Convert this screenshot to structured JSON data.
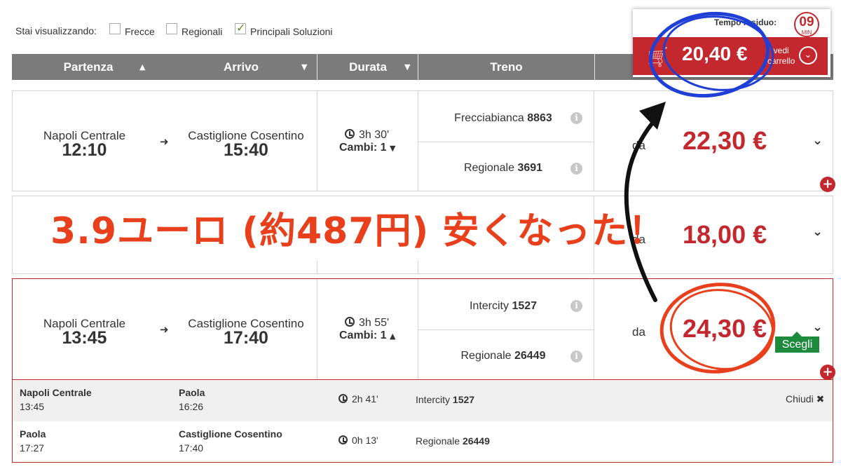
{
  "filters": {
    "label": "Stai visualizzando:",
    "options": [
      {
        "label": "Frecce",
        "checked": false
      },
      {
        "label": "Regionali",
        "checked": false
      },
      {
        "label": "Principali Soluzioni",
        "checked": true
      }
    ]
  },
  "table_header": {
    "partenza": "Partenza",
    "arrivo": "Arrivo",
    "durata": "Durata",
    "treno": "Treno"
  },
  "cart": {
    "tempo_label": "Tempo residuo:",
    "timer_value": "09",
    "timer_unit": "MIN",
    "price": "20,40 €",
    "vedi_line1": "vedi",
    "vedi_line2": "carrello"
  },
  "solutions": [
    {
      "from_station": "Napoli Centrale",
      "from_time": "12:10",
      "to_station": "Castiglione Cosentino",
      "to_time": "15:40",
      "duration": "3h 30'",
      "cambi": "Cambi: 1",
      "trains": [
        {
          "type": "Frecciabianca",
          "number": "8863"
        },
        {
          "type": "Regionale",
          "number": "3691"
        }
      ],
      "da": "da",
      "price": "22,30 €"
    },
    {
      "da": "da",
      "price": "18,00 €"
    },
    {
      "from_station": "Napoli Centrale",
      "from_time": "13:45",
      "to_station": "Castiglione Cosentino",
      "to_time": "17:40",
      "duration": "3h 55'",
      "cambi": "Cambi: 1",
      "trains": [
        {
          "type": "Intercity",
          "number": "1527"
        },
        {
          "type": "Regionale",
          "number": "26449"
        }
      ],
      "da": "da",
      "price": "24,30 €",
      "select_label": "Scegli",
      "details": [
        {
          "from_station": "Napoli Centrale",
          "from_time": "13:45",
          "to_station": "Paola",
          "to_time": "16:26",
          "duration": "2h 41'",
          "train_type": "Intercity",
          "train_number": "1527"
        },
        {
          "from_station": "Paola",
          "from_time": "17:27",
          "to_station": "Castiglione Cosentino",
          "to_time": "17:40",
          "duration": "0h 13'",
          "train_type": "Regionale",
          "train_number": "26449"
        }
      ],
      "close_label": "Chiudi"
    }
  ],
  "annotation": {
    "text": "3.9ユーロ (約487円) 安くなった！",
    "colors": {
      "text": "#e8401c",
      "blue_circle": "#1f3fd6",
      "red_circle": "#e8401c",
      "arrow": "#111111"
    }
  },
  "colors": {
    "price_red": "#c2282e",
    "header_gray": "#7b7b7b",
    "scegli_green": "#1e8a3c"
  }
}
